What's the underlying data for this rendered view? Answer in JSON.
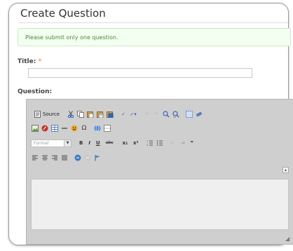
{
  "page_title": "Create Question",
  "notice": "Please submit only one question.",
  "title_field": {
    "label": "Title:",
    "required_marker": "*",
    "value": ""
  },
  "question_field": {
    "label": "Question:"
  },
  "toolbar": {
    "source_label": "Source",
    "format_label": "Format",
    "bold_label": "B",
    "italic_label": "I",
    "underline_label": "U",
    "strike_label": "abc",
    "subscript_label": "x₂",
    "superscript_label": "x²",
    "blockquote_label": "❞"
  },
  "colors": {
    "notice_bg": "#f3fff0",
    "notice_text": "#4a8a3a",
    "required": "#e8a13a",
    "editor_bg": "#cfcfcf"
  }
}
